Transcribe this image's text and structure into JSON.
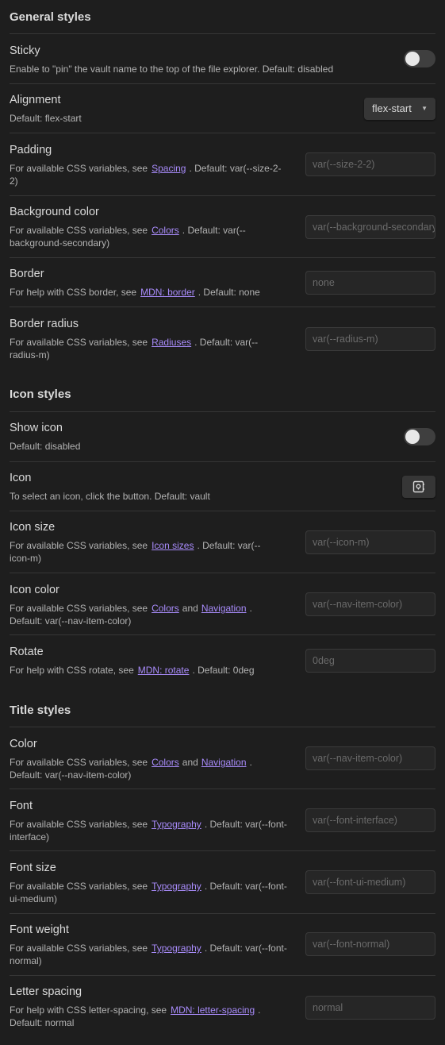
{
  "general": {
    "heading": "General styles",
    "sticky": {
      "name": "Sticky",
      "desc": "Enable to \"pin\" the vault name to the top of the file explorer. Default: disabled",
      "toggle_on": false
    },
    "alignment": {
      "name": "Alignment",
      "desc": "Default: flex-start",
      "value": "flex-start"
    },
    "padding": {
      "name": "Padding",
      "desc_pre": "For available CSS variables, see",
      "link": "Spacing",
      "desc_post": ". Default: var(--size-2-2)",
      "placeholder": "var(--size-2-2)"
    },
    "background": {
      "name": "Background color",
      "desc_pre": "For available CSS variables, see",
      "link": "Colors",
      "desc_post": ". Default: var(--background-secondary)",
      "placeholder": "var(--background-secondary)"
    },
    "border": {
      "name": "Border",
      "desc_pre": "For help with CSS border, see",
      "link": "MDN: border",
      "desc_post": ". Default: none",
      "placeholder": "none"
    },
    "radius": {
      "name": "Border radius",
      "desc_pre": "For available CSS variables, see",
      "link": "Radiuses",
      "desc_post": ". Default: var(--radius-m)",
      "placeholder": "var(--radius-m)"
    }
  },
  "icon": {
    "heading": "Icon styles",
    "show": {
      "name": "Show icon",
      "desc": "Default: disabled",
      "toggle_on": false
    },
    "icon": {
      "name": "Icon",
      "desc": "To select an icon, click the button. Default: vault",
      "button_icon": "vault-icon"
    },
    "size": {
      "name": "Icon size",
      "desc_pre": "For available CSS variables, see",
      "link": "Icon sizes",
      "desc_post": ". Default: var(--icon-m)",
      "placeholder": "var(--icon-m)"
    },
    "color": {
      "name": "Icon color",
      "desc_pre": "For available CSS variables, see",
      "link1": "Colors",
      "mid": "and",
      "link2": "Navigation",
      "desc_post": ". Default: var(--nav-item-color)",
      "placeholder": "var(--nav-item-color)"
    },
    "rotate": {
      "name": "Rotate",
      "desc_pre": "For help with CSS rotate, see",
      "link": "MDN: rotate",
      "desc_post": ". Default: 0deg",
      "placeholder": "0deg"
    }
  },
  "title": {
    "heading": "Title styles",
    "color": {
      "name": "Color",
      "desc_pre": "For available CSS variables, see",
      "link1": "Colors",
      "mid": "and",
      "link2": "Navigation",
      "desc_post": ". Default: var(--nav-item-color)",
      "placeholder": "var(--nav-item-color)"
    },
    "font": {
      "name": "Font",
      "desc_pre": "For available CSS variables, see",
      "link": "Typography",
      "desc_post": ". Default: var(--font-interface)",
      "placeholder": "var(--font-interface)"
    },
    "font_size": {
      "name": "Font size",
      "desc_pre": "For available CSS variables, see",
      "link": "Typography",
      "desc_post": ". Default: var(--font-ui-medium)",
      "placeholder": "var(--font-ui-medium)"
    },
    "font_weight": {
      "name": "Font weight",
      "desc_pre": "For available CSS variables, see",
      "link": "Typography",
      "desc_post": ". Default: var(--font-normal)",
      "placeholder": "var(--font-normal)"
    },
    "letter_spacing": {
      "name": "Letter spacing",
      "desc_pre": "For help with CSS letter-spacing, see",
      "link": "MDN: letter-spacing",
      "desc_post": ". Default: normal",
      "placeholder": "normal"
    }
  },
  "colors": {
    "background": "#1e1e1e",
    "link": "#a88bfa",
    "text": "#dadada",
    "muted": "#b3b3b3"
  }
}
